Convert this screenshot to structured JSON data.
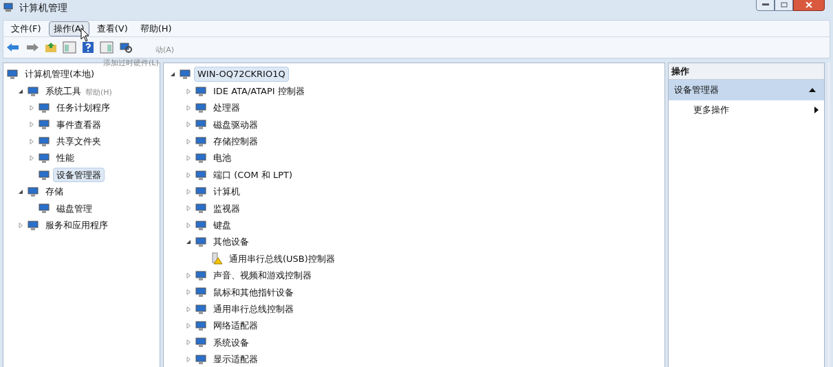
{
  "window": {
    "title": "计算机管理"
  },
  "menu": [
    {
      "label": "文件(F)",
      "selected": false
    },
    {
      "label": "操作(A)",
      "selected": true
    },
    {
      "label": "查看(V)",
      "selected": false
    },
    {
      "label": "帮助(H)",
      "selected": false
    }
  ],
  "fading_menu": [
    "动(A)",
    "添加过时硬件(L)",
    "帮助(H)"
  ],
  "nav_tree": [
    {
      "label": "计算机管理(本地)",
      "selected": false,
      "children": [
        {
          "label": "系统工具",
          "expanded": true,
          "selected": false,
          "children": [
            {
              "label": "任务计划程序",
              "expanded": false,
              "selected": false
            },
            {
              "label": "事件查看器",
              "expanded": false,
              "selected": false
            },
            {
              "label": "共享文件夹",
              "expanded": false,
              "selected": false
            },
            {
              "label": "性能",
              "expanded": false,
              "selected": false
            },
            {
              "label": "设备管理器",
              "selected": true
            }
          ]
        },
        {
          "label": "存储",
          "expanded": true,
          "selected": false,
          "children": [
            {
              "label": "磁盘管理",
              "selected": false
            }
          ]
        },
        {
          "label": "服务和应用程序",
          "expanded": false,
          "selected": false
        }
      ]
    }
  ],
  "device_tree": [
    {
      "label": "WIN-OQ72CKRIO1Q",
      "expanded": true,
      "selected": true,
      "children": [
        {
          "label": "IDE ATA/ATAPI 控制器",
          "expanded": false,
          "selected": false
        },
        {
          "label": "处理器",
          "expanded": false,
          "selected": false
        },
        {
          "label": "磁盘驱动器",
          "expanded": false,
          "selected": false
        },
        {
          "label": "存储控制器",
          "expanded": false,
          "selected": false
        },
        {
          "label": "电池",
          "expanded": false,
          "selected": false
        },
        {
          "label": "端口 (COM 和 LPT)",
          "expanded": false,
          "selected": false
        },
        {
          "label": "计算机",
          "expanded": false,
          "selected": false
        },
        {
          "label": "监视器",
          "expanded": false,
          "selected": false
        },
        {
          "label": "键盘",
          "expanded": false,
          "selected": false
        },
        {
          "label": "其他设备",
          "expanded": true,
          "selected": false,
          "children": [
            {
              "label": "通用串行总线(USB)控制器",
              "selected": false,
              "warning": true
            }
          ]
        },
        {
          "label": "声音、视频和游戏控制器",
          "expanded": false,
          "selected": false
        },
        {
          "label": "鼠标和其他指针设备",
          "expanded": false,
          "selected": false
        },
        {
          "label": "通用串行总线控制器",
          "expanded": false,
          "selected": false
        },
        {
          "label": "网络适配器",
          "expanded": false,
          "selected": false
        },
        {
          "label": "系统设备",
          "expanded": false,
          "selected": false
        },
        {
          "label": "显示适配器",
          "expanded": false,
          "selected": false
        }
      ]
    }
  ],
  "actions": {
    "title": "操作",
    "section": {
      "label": "设备管理器",
      "expanded": true,
      "items": [
        {
          "label": "更多操作"
        }
      ]
    }
  }
}
